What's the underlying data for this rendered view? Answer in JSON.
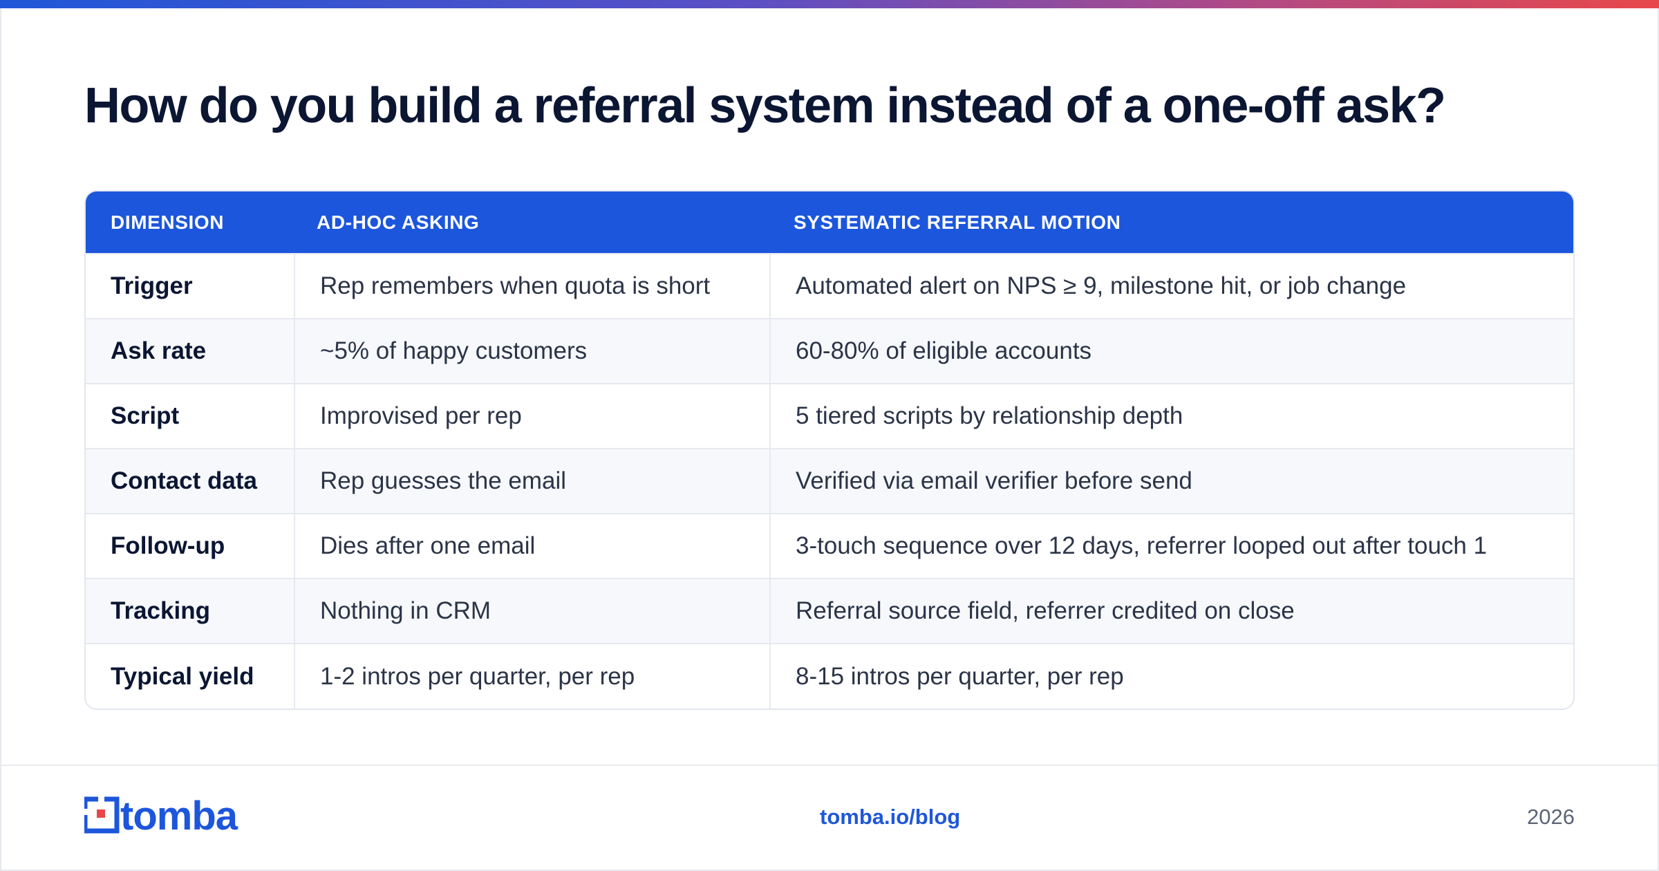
{
  "title": "How do you build a referral system instead of a one-off ask?",
  "accent_color": "#1c56dc",
  "table": {
    "headers": [
      "DIMENSION",
      "AD-HOC ASKING",
      "SYSTEMATIC REFERRAL MOTION"
    ],
    "rows": [
      {
        "dimension": "Trigger",
        "adhoc": "Rep remembers when quota is short",
        "systematic": "Automated alert on NPS ≥ 9, milestone hit, or job change"
      },
      {
        "dimension": "Ask rate",
        "adhoc": "~5% of happy customers",
        "systematic": "60-80% of eligible accounts"
      },
      {
        "dimension": "Script",
        "adhoc": "Improvised per rep",
        "systematic": "5 tiered scripts by relationship depth"
      },
      {
        "dimension": "Contact data",
        "adhoc": "Rep guesses the email",
        "systematic": "Verified via email verifier before send"
      },
      {
        "dimension": "Follow-up",
        "adhoc": "Dies after one email",
        "systematic": "3-touch sequence over 12 days, referrer looped out after touch 1"
      },
      {
        "dimension": "Tracking",
        "adhoc": "Nothing in CRM",
        "systematic": "Referral source field, referrer credited on close"
      },
      {
        "dimension": "Typical yield",
        "adhoc": "1-2 intros per quarter, per rep",
        "systematic": "8-15 intros per quarter, per rep"
      }
    ]
  },
  "footer": {
    "logo_text": "tomba",
    "logo_icon": "tomba-logo-icon",
    "link": "tomba.io/blog",
    "year": "2026"
  }
}
